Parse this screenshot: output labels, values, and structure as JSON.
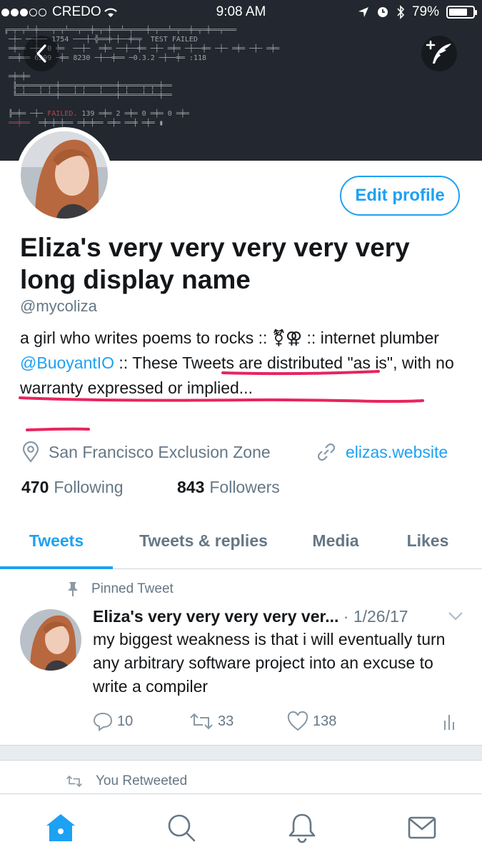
{
  "status_bar": {
    "carrier": "CREDO",
    "time": "9:08 AM",
    "battery_text": "79%",
    "battery_level": 0.79
  },
  "banner": {
    "terminal_failed_1": "TEST FAILED",
    "terminal_line_1": "1754",
    "terminal_line_2": "6299",
    "terminal_line_3": "8230",
    "terminal_failed_2": "FAILED."
  },
  "profile": {
    "edit_profile_label": "Edit profile",
    "display_name": "Eliza's very very very very very long display name",
    "handle": "@mycoliza",
    "bio_part1": "a girl who writes poems to rocks :: ⚧⚢ :: internet plumber ",
    "bio_link": "@BuoyantIO",
    "bio_part2": " :: These Tweets are distributed \"as is\", with no warranty expressed or implied...",
    "location": "San Francisco Exclusion Zone",
    "website": "elizas.website",
    "following_count": "470",
    "following_label": "Following",
    "followers_count": "843",
    "followers_label": "Followers"
  },
  "tabs": [
    {
      "label": "Tweets",
      "active": true
    },
    {
      "label": "Tweets & replies",
      "active": false
    },
    {
      "label": "Media",
      "active": false
    },
    {
      "label": "Likes",
      "active": false
    }
  ],
  "pinned_tweet": {
    "label": "Pinned Tweet",
    "author": "Eliza's very very very very ver...",
    "date": "· 1/26/17",
    "text": "my biggest weakness is that i will eventually turn any arbitrary software project into an excuse to write a compiler",
    "replies": "10",
    "retweets": "33",
    "likes": "138"
  },
  "retweet_notice": {
    "label": "You Retweeted"
  },
  "bottom_nav": {
    "active": "home",
    "icons": [
      "home-icon",
      "search-icon",
      "bell-icon",
      "mail-icon"
    ]
  },
  "colors": {
    "accent": "#1da1f2",
    "banner_bg": "#23272f",
    "muted": "#657786",
    "highlight_underline": "#e8245f"
  }
}
